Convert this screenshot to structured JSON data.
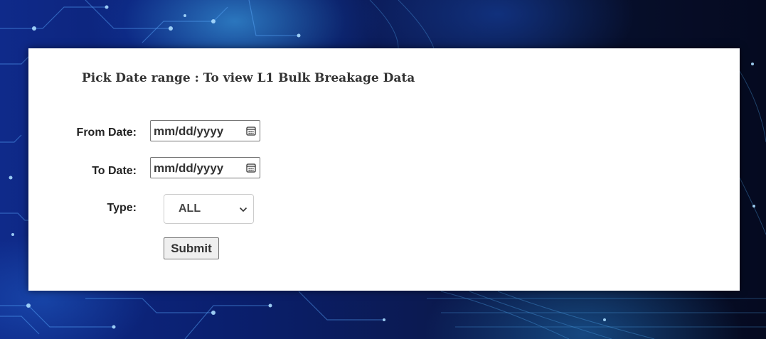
{
  "title": "Pick Date range : To view L1 Bulk Breakage Data",
  "form": {
    "from_label": "From Date:",
    "from_value": "mm/dd/yyyy",
    "to_label": "To Date:",
    "to_value": "mm/dd/yyyy",
    "type_label": "Type:",
    "type_selected": "ALL",
    "submit_label": "Submit"
  },
  "icons": {
    "date_picker": "calendar-icon",
    "select_arrow": "chevron-down-icon"
  }
}
